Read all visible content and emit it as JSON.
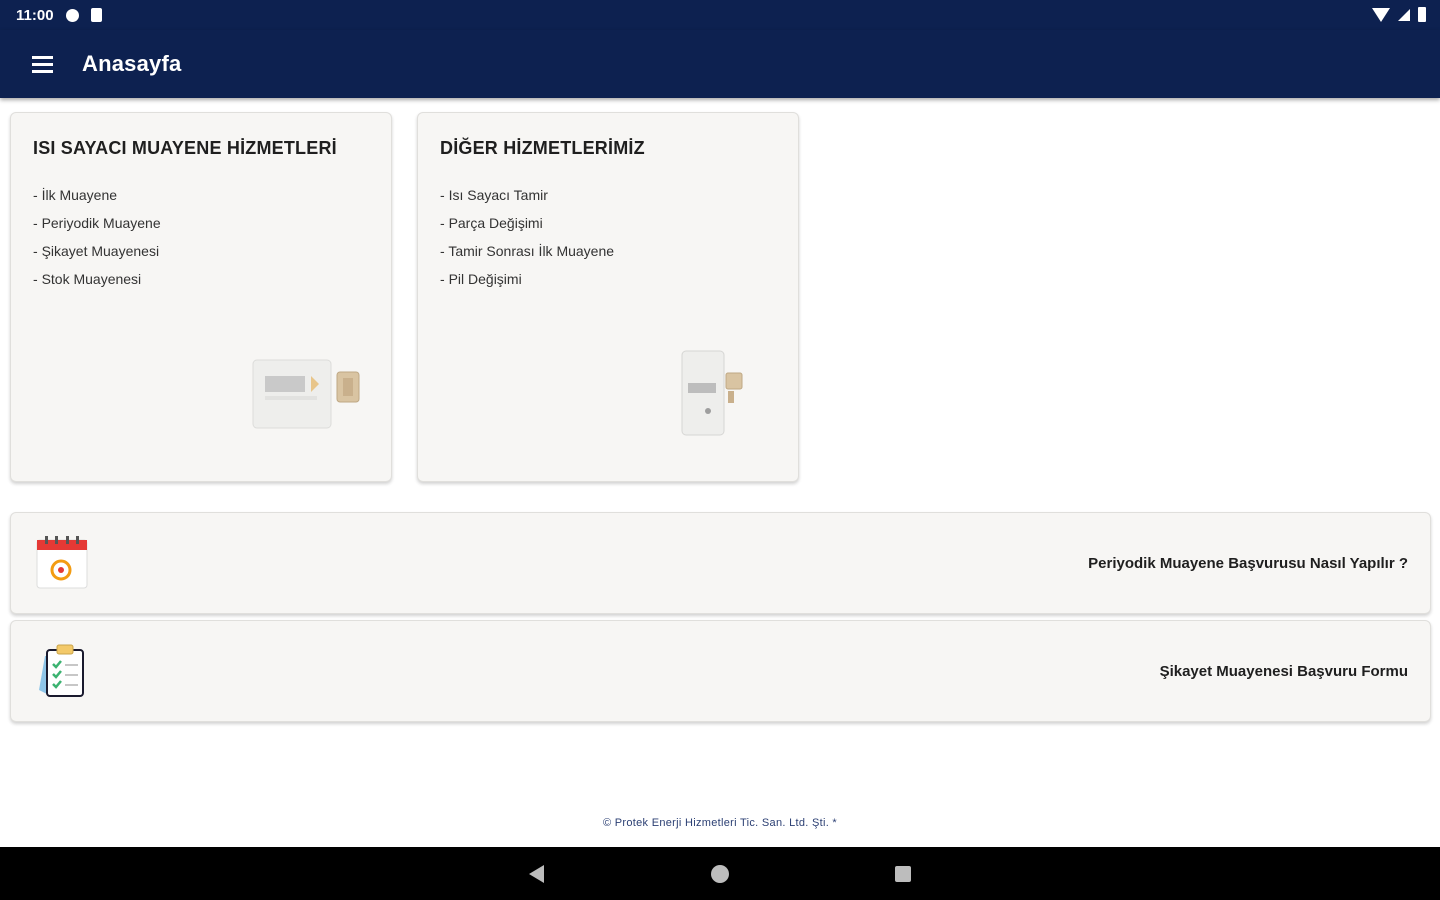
{
  "status_bar": {
    "time": "11:00",
    "left_icons": [
      "gear-icon",
      "sd-card-icon"
    ],
    "right_icons": [
      "wifi-icon",
      "signal-icon",
      "battery-icon"
    ]
  },
  "app_bar": {
    "menu_icon": "menu-icon",
    "title": "Anasayfa",
    "color": "#0d2150"
  },
  "service_cards": [
    {
      "title": "ISI SAYACI MUAYENE HİZMETLERİ",
      "items": [
        "İlk Muayene",
        "Periyodik Muayene",
        "Şikayet Muayenesi",
        "Stok Muayenesi"
      ],
      "image": "heat-meter-image"
    },
    {
      "title": "DİĞER HİZMETLERİMİZ",
      "items": [
        "Isı Sayacı Tamir",
        "Parça Değişimi",
        "Tamir Sonrası İlk Muayene",
        "Pil Değişimi"
      ],
      "image": "meter-device-image"
    }
  ],
  "action_cards": [
    {
      "icon": "calendar-icon",
      "label": "Periyodik Muayene Başvurusu Nasıl Yapılır ?"
    },
    {
      "icon": "clipboard-checklist-icon",
      "label": "Şikayet Muayenesi Başvuru Formu"
    }
  ],
  "footer": {
    "text": "© Protek Enerji Hizmetleri Tic. San. Ltd. Şti. *"
  },
  "nav_bar": {
    "buttons": [
      "back-icon",
      "home-icon",
      "recent-apps-icon"
    ]
  }
}
